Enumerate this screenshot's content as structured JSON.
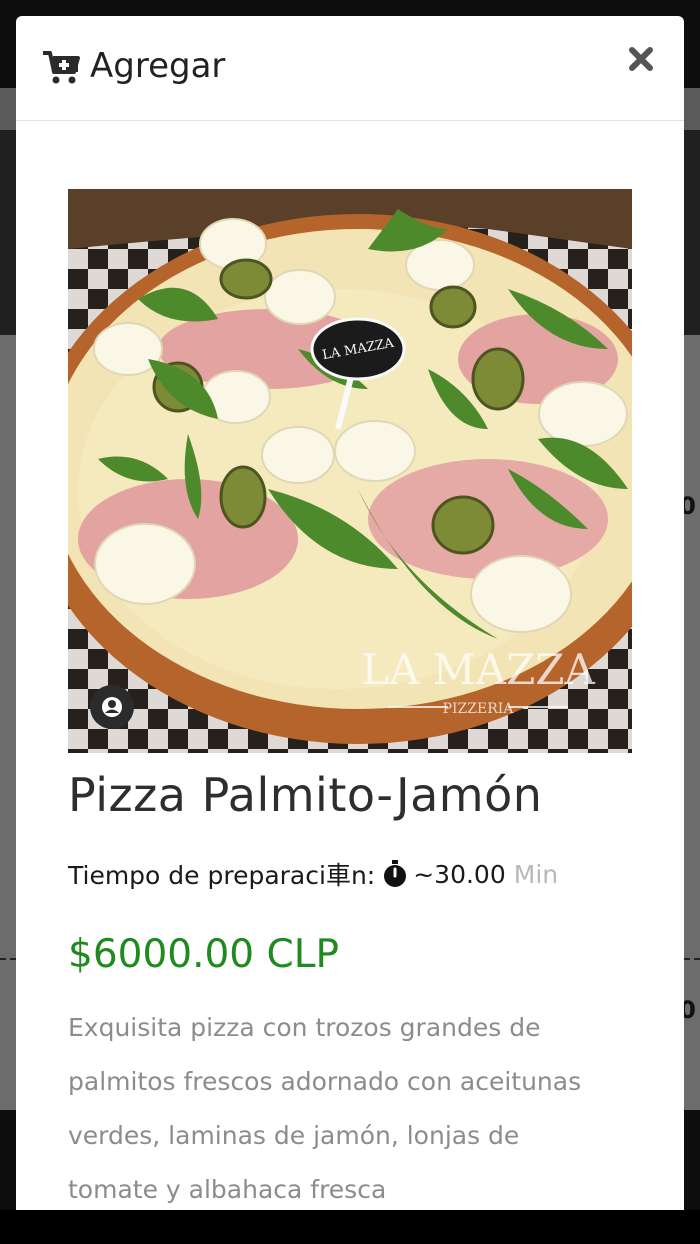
{
  "modal": {
    "title": "Agregar",
    "close_icon": "times-icon",
    "cart_icon": "cart-plus-icon"
  },
  "product": {
    "name": "Pizza Palmito-Jamón",
    "image_alt": "Pizza with ham, hearts of palm, green olives and basil",
    "watermark_brand": "LA MAZZA",
    "watermark_sub": "PIZZERIA",
    "prep_label": "Tiempo de preparaci車n:",
    "prep_value": "~30.00",
    "prep_unit": "Min",
    "price": "$6000.00 CLP",
    "description": "Exquisita pizza con trozos grandes de palmitos frescos adornado con aceitunas verdes, laminas de jamón, lonjas de tomate y albahaca fresca"
  },
  "background": {
    "number_a": "0",
    "number_b": "0"
  },
  "colors": {
    "price": "#1f8a1f",
    "title": "#222222",
    "description": "#8c8c8c",
    "unit": "#b8b8b8"
  }
}
